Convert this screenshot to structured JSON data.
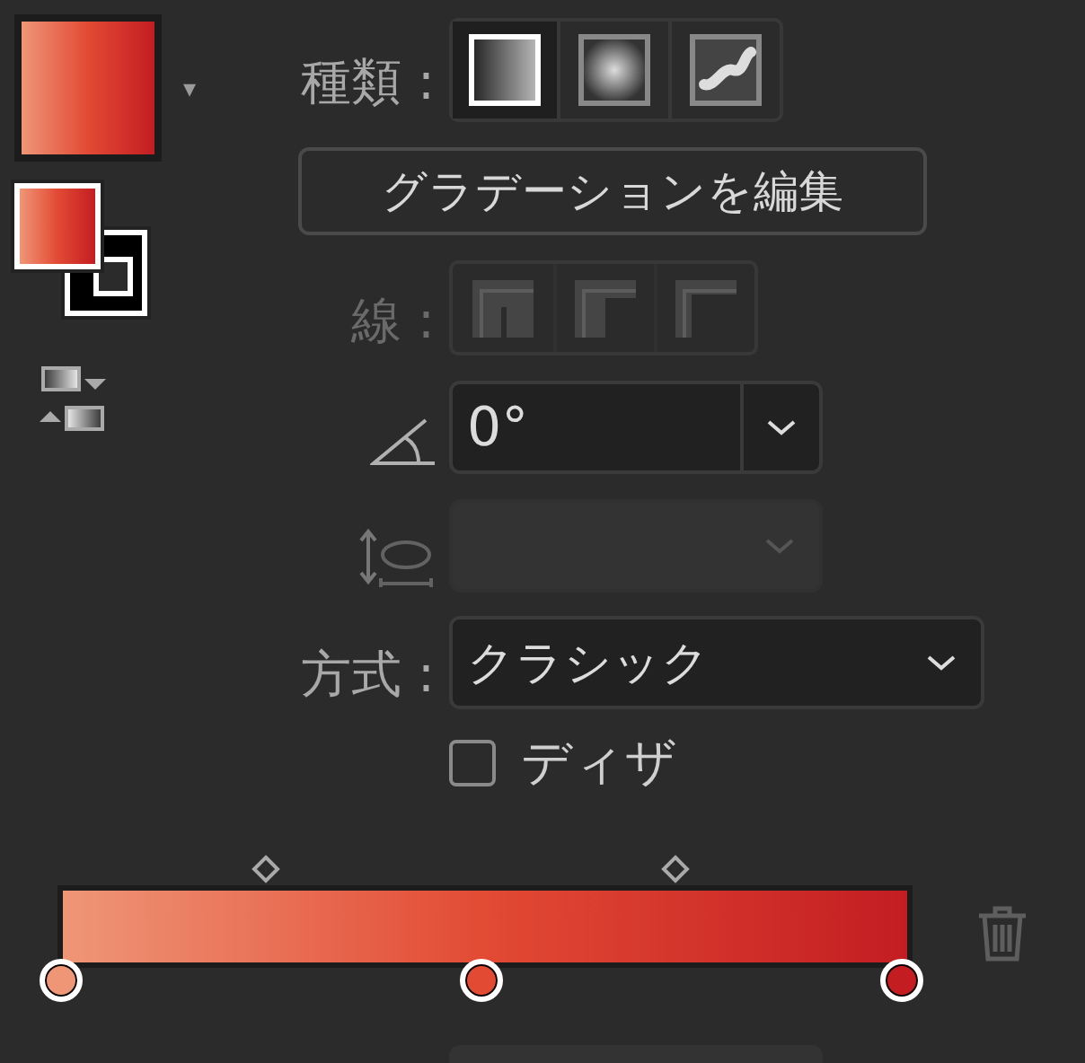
{
  "fill_menu": {
    "caret": "▾"
  },
  "type": {
    "label": "種類 :",
    "options": [
      {
        "kind": "linear",
        "selected": true
      },
      {
        "kind": "radial",
        "selected": false
      },
      {
        "kind": "freeform",
        "selected": false
      }
    ]
  },
  "edit_button": "グラデーションを編集",
  "stroke": {
    "label": "線 :",
    "disabled": true,
    "options": [
      {
        "kind": "within"
      },
      {
        "kind": "along"
      },
      {
        "kind": "across"
      }
    ]
  },
  "angle": {
    "value": "0°"
  },
  "aspect": {
    "disabled": true
  },
  "method": {
    "label": "方式 :",
    "value": "クラシック"
  },
  "dither": {
    "label": "ディザ",
    "checked": false
  },
  "gradient": {
    "stops": [
      {
        "color": "#ef9677"
      },
      {
        "color": "#e24a34"
      },
      {
        "color": "#c31d22"
      }
    ]
  }
}
